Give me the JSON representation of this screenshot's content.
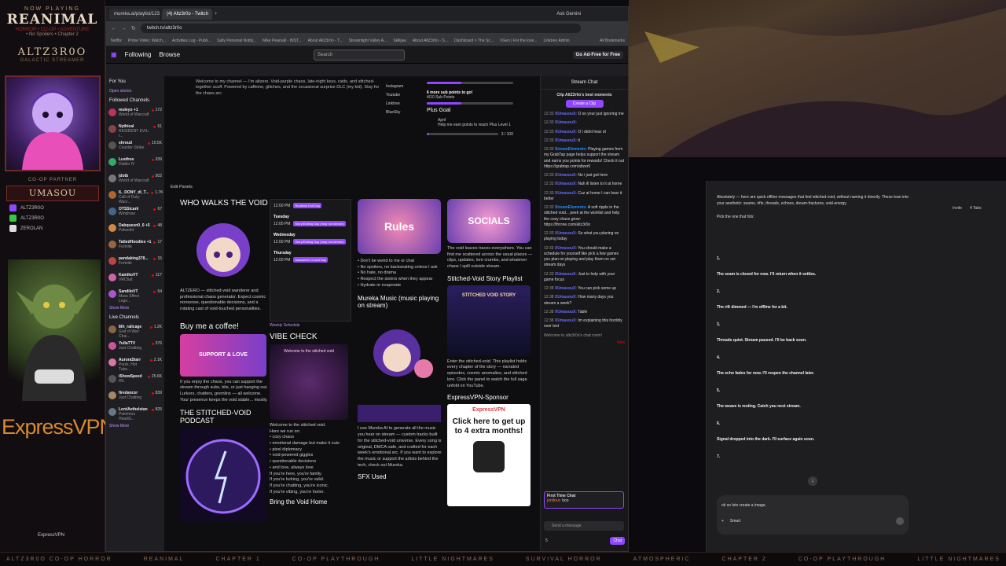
{
  "overlay": {
    "now_playing": "NOW PLAYING",
    "game": "REANIMAL",
    "game_sub1": "HORROR • CO-OP • ADVENTURE",
    "game_sub2": "• No Spoilers • Chapter 2",
    "streamer": "ALTZ3R0O",
    "streamer_sub": "GALACTIC STREAMER",
    "coop_header": "CO-OP PARTNER",
    "partner": "UMASOU",
    "squad": [
      {
        "name": "ALTZ3R0O",
        "color": "#9147ff"
      },
      {
        "name": "ALTZ3R0O",
        "color": "#2ecc40"
      },
      {
        "name": "ZEROLAN",
        "color": "#dddddd"
      }
    ],
    "sponsor": "ExpressVPN",
    "sponsor_small": "ExpressVPN",
    "footer_brand": "ALTZ3R0O"
  },
  "ticker": [
    "ALTZ3R0O CO-OP HORROR",
    "REANIMAL",
    "CHAPTER 1",
    "CO-OP PLAYTHROUGH",
    "LITTLE NIGHTMARES",
    "SURVIVAL HORROR",
    "ATMOSPHERIC",
    "CHAPTER 2",
    "CO-OP PLAYTHROUGH",
    "LITTLE NIGHTMARES"
  ],
  "browser": {
    "tabs": [
      "mureka.ai/playlist/123240857...",
      "(4) Altz3r0o - Twitch"
    ],
    "ask_gemini": "Ask Gemini",
    "url": "twitch.tv/altz3r0o",
    "bookmarks": [
      "Netflix",
      "Prime Video: Watch...",
      "Activities Log - Publi...",
      "Sally Personal Notify...",
      "Mike Pearsall - INST...",
      "About AltZ3r0o - T...",
      "Streamlight Valley A...",
      "Skilljaw",
      "About AltZ3r0o - S...",
      "Dashboard > The Sc...",
      "VGen | For the love...",
      "Linktree Admin"
    ],
    "all_bookmarks": "All Bookmarks"
  },
  "twitch_nav": {
    "following": "Following",
    "browse": "Browse",
    "search_placeholder": "Search",
    "adfree": "Go Ad-Free for Free"
  },
  "sidebar": {
    "for_you": "For You",
    "open_stories": "Open stories",
    "followed": "Followed Channels",
    "channels": [
      {
        "name": "muleyo +1",
        "game": "World of Warcraft",
        "viewers": "172",
        "color": "#b35"
      },
      {
        "name": "Nythical",
        "game": "RESIDENT EVIL: r...",
        "viewers": "61",
        "color": "#844"
      },
      {
        "name": "shroud",
        "game": "Counter-Strike",
        "viewers": "10.5K",
        "color": "#555"
      },
      {
        "name": "Lusthos",
        "game": "Diablo IV",
        "viewers": "339",
        "color": "#3a6"
      },
      {
        "name": "jdotb",
        "game": "World of Warcraft",
        "viewers": "502",
        "color": "#777"
      },
      {
        "name": "IL_DONY_di_T...",
        "game": "Call of Duty: Warz...",
        "viewers": "1.7K",
        "color": "#a63"
      },
      {
        "name": "OTSSicarii",
        "game": "Windrose",
        "viewers": "67",
        "color": "#468"
      },
      {
        "name": "Dabquesn0_0 +5",
        "game": "Palworld",
        "viewers": "48",
        "color": "#c84"
      },
      {
        "name": "TattedHoodies +1",
        "game": "Fortnite",
        "viewers": "17",
        "color": "#964"
      },
      {
        "name": "pandaking378...",
        "game": "Fortnite",
        "viewers": "15",
        "color": "#b44"
      },
      {
        "name": "KamikoVT",
        "game": "VRChat",
        "viewers": "117",
        "color": "#c6a"
      },
      {
        "name": "SandiloVT",
        "game": "Mass Effect Lege...",
        "viewers": "54",
        "color": "#a5c"
      }
    ],
    "show_more": "Show More",
    "live_header": "Live Channels",
    "live": [
      {
        "name": "8th_railcage",
        "game": "God of War: Chai...",
        "viewers": "1.2K",
        "color": "#864"
      },
      {
        "name": "YullaTTV",
        "game": "Just Chatting",
        "viewers": "376",
        "color": "#c59"
      },
      {
        "name": "AuroraStarr",
        "game": "Pools, Hot Tubs...",
        "viewers": "2.1K",
        "color": "#d7a"
      },
      {
        "name": "iShowSpeed",
        "game": "IRL",
        "viewers": "25.6K",
        "color": "#555"
      },
      {
        "name": "firedancer",
        "game": "Just Chatting",
        "viewers": "839",
        "color": "#a86"
      },
      {
        "name": "LordAethelstan",
        "game": "Pokémon HeartG...",
        "viewers": "825",
        "color": "#678"
      }
    ],
    "show_more2": "Show More"
  },
  "content": {
    "about": "Welcome to my channel — I'm altzero. Void-purple chaos, late-night keys, raids, and stitched-together scuff. Powered by caffeine, glitches, and the occasional surprise DLC (my kid). Stay for the chaos arc.",
    "socials": [
      "Instagram",
      "Youtube",
      "Linktree",
      "BlueSky"
    ],
    "sub_goal": "6 more sub points to go!",
    "sub_goal_sub": "4/10 Sub Points",
    "plus_goal": "Plus Goal",
    "plus_month": "April",
    "plus_desc": "Help me earn points to reach Plus Level 1",
    "plus_count": "3 / 100",
    "edit_panels": "Edit Panels",
    "who_walks": "WHO WALKS THE VOID",
    "who_text": "ALTZERO — stitched-void wanderer and professional chaos generator. Expect cosmic nonsense, questionable decisions, and a rotating cast of void-touched personalities.",
    "coffee": "Buy me a coffee!",
    "coffee_text": "If you enjoy the chaos, you can support the stream through subs, bits, or just hanging out. Lurkers, chatters, gremlins — all welcome. Your presence keeps the void stable... mostly.",
    "podcast": "THE STITCHED-VOID PODCAST",
    "schedule": [
      {
        "time": "12:00 PM",
        "tag": "Realtime Exit Day"
      },
      {
        "day": "Tuesday",
        "time": "12:00 PM",
        "tag": "Story/Editing Day (may not stream)"
      },
      {
        "day": "Wednesday",
        "time": "12:00 PM",
        "tag": "Story/Editing Day (may not stream)"
      },
      {
        "day": "Thursday",
        "time": "12:00 PM",
        "tag": "Aaaaand's Crowd Day"
      }
    ],
    "weekly_schedule": "Weekly Schedule",
    "vibe_check": "VIBE CHECK",
    "vibe_banner": "Welcome to the stitched void",
    "vibe_text": "Welcome to the stitched void.\nHere we run on:\n• cozy chaos\n• emotional damage but make it cute\n• pixel diplomacy\n• void-powered giggles\n• questionable decisions\n• and love, always love\nIf you're here, you're family.\nIf you're lurking, you're valid.\nIf you're chatting, you're iconic.\nIf you're vibing, you're home.",
    "bring_void": "Bring the Void Home",
    "rules_title": "Rules",
    "rules_text": "• Don't be weird to me or chat\n• No spoilers, no backseating unless I ask\n• No hate, no drama\n• Respect the sisters when they appear\n• Hydrate or evaporate",
    "mureka_title": "Mureka Music (music playing on stream)",
    "mureka_banner": "Mureka Music",
    "mureka_text": "I use Mureka AI to generate all the music you hear on stream — custom tracks built for the stitched-void universe. Every song is original, DMCA-safe, and crafted for each week's emotional arc. If you want to explore the music or support the artists behind the tech, check out Mureka.",
    "sfx": "SFX Used",
    "socials_title": "SOCIALS",
    "socials_text": "The void leaves traces everywhere. You can find me scattered across the usual places — clips, updates, lore crumbs, and whatever chaos I spill outside stream.",
    "story_title": "Stitched-Void Story Playlist",
    "story_banner": "STITCHED VOID STORY",
    "story_text": "Enter the stitched-void. This playlist holds every chapter of the story — narrated episodes, cosmic anomalies, and stitched lore. Click the panel to watch the full saga unfold on YouTube.",
    "evpn_title": "ExpressVPN-Sponsor",
    "evpn_logo": "ExpressVPN",
    "evpn_cta": "Click here to get up to 4 extra months!"
  },
  "chat": {
    "title": "Stream Chat",
    "clip_title": "Clip AltZ3r0o's best moments",
    "create_clip": "Create a Clip",
    "messages": [
      {
        "time": "12:33",
        "user": "XUmasouX:",
        "text": "O so your just ignoring me"
      },
      {
        "time": "12:33",
        "user": "XUmasouX:",
        "text": ""
      },
      {
        "time": "12:33",
        "user": "XUmasouX:",
        "text": "O i didnt hear ot"
      },
      {
        "time": "12:33",
        "user": "XUmasouX:",
        "text": "it"
      },
      {
        "time": "12:33",
        "user": "StreamElements:",
        "text": "Playing games from my GrabTap page helps support the stream and earns you points for rewards! Check it out https://grabtap.com/altzer0"
      },
      {
        "time": "12:33",
        "user": "XUmasouX:",
        "text": "No i just got here"
      },
      {
        "time": "12:33",
        "user": "XUmasouX:",
        "text": "Nah ill listen to it at home"
      },
      {
        "time": "12:33",
        "user": "XUmasouX:",
        "text": "Cuz at home I can hear it better"
      },
      {
        "time": "12:33",
        "user": "StreamElements:",
        "text": "A soft ripple in the stitched void... peek at the wishlist and help the cozy chaos grow: https://throne.com/altz3r0o"
      },
      {
        "time": "12:33",
        "user": "XUmasouX:",
        "text": "So what you planing on playing today"
      },
      {
        "time": "12:33",
        "user": "XUmasouX:",
        "text": "You should make a schedule for yourself like pick a few games you plan on playing and play them on set stream days"
      },
      {
        "time": "12:33",
        "user": "XUmasouX:",
        "text": "Just to help with your game focus"
      },
      {
        "time": "12:38",
        "user": "XUmasouX:",
        "text": "You can pick some up"
      },
      {
        "time": "12:38",
        "user": "XUmasouX:",
        "text": "How many days you stream a week?"
      },
      {
        "time": "12:38",
        "user": "XUmasouX:",
        "text": "Table"
      },
      {
        "time": "12:38",
        "user": "XUmasouX:",
        "text": "Im explaining this horribly over text"
      }
    ],
    "welcome": "Welcome to altz3r0o's chat room!",
    "new_label": "New",
    "first_time": "First Time Chat",
    "first_user": "jonifour:",
    "first_msg": "boo",
    "input_placeholder": "Send a message",
    "points": "5",
    "chat_button": "Chat"
  },
  "gpt": {
    "share": "Invite",
    "tabs": "4 Tabs",
    "intro": "Absolutely — here are quick offline messages that feel stitched-void, without naming it directly. These lean into your aesthetic: seams, rifts, threads, echoes, dream-fractures, void-energy.",
    "pick": "Pick the one that hits:",
    "items": [
      {
        "n": "1.",
        "text": "The seam is closed for now. I'll return when it settles."
      },
      {
        "n": "2.",
        "text": "The rift dimmed — I'm offline for a bit."
      },
      {
        "n": "3.",
        "text": "Threads quiet. Stream paused. I'll be back soon."
      },
      {
        "n": "4.",
        "text": "The echo fades for now. I'll reopen the channel later."
      },
      {
        "n": "5.",
        "text": "The weave is resting. Catch you next stream."
      },
      {
        "n": "6.",
        "text": "Signal dropped into the dark. I'll surface again soon."
      },
      {
        "n": "7.",
        "text": ""
      }
    ],
    "compose_text": "ok so lets create a image,",
    "model": "Smart"
  }
}
